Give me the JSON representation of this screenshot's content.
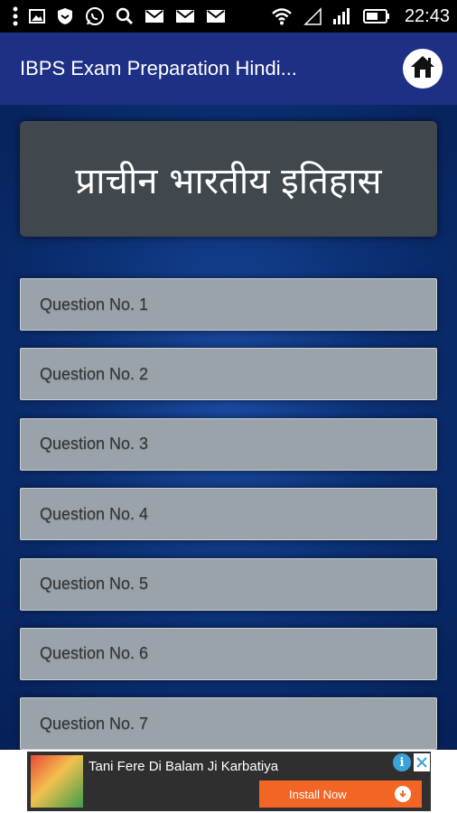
{
  "status_bar": {
    "time": "22:43",
    "left_icons": [
      "more-vert-icon",
      "image-icon",
      "shield-app-icon",
      "whatsapp-icon",
      "search-icon",
      "gmail-icon",
      "gmail-icon",
      "gmail-icon"
    ],
    "right_icons": [
      "wifi-icon",
      "signal-empty-icon",
      "signal-full-icon",
      "battery-icon"
    ]
  },
  "app_bar": {
    "title": "IBPS Exam Preparation Hindi...",
    "home_icon": "home-icon"
  },
  "header": {
    "title": "प्राचीन भारतीय इतिहास"
  },
  "questions": [
    {
      "label": "Question No. 1"
    },
    {
      "label": "Question No. 2"
    },
    {
      "label": "Question No. 3"
    },
    {
      "label": "Question No. 4"
    },
    {
      "label": "Question No. 5"
    },
    {
      "label": "Question No. 6"
    },
    {
      "label": "Question No. 7"
    }
  ],
  "ad": {
    "title": "Tani Fere Di Balam Ji Karbatiya",
    "button": "Install Now"
  },
  "colors": {
    "app_bar": "#1e2f86",
    "header_card": "#40474d",
    "question_item": "#9aa3aa",
    "install_button": "#f26524"
  }
}
